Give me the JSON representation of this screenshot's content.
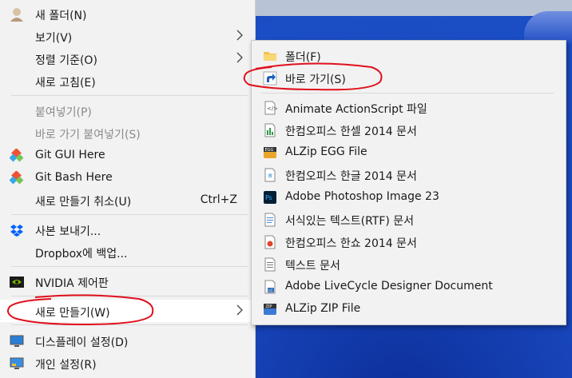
{
  "context_menu": {
    "items": [
      {
        "label": "새 폴더(N)",
        "icon": "avatar-icon"
      },
      {
        "label": "보기(V)",
        "has_submenu": true
      },
      {
        "label": "정렬 기준(O)",
        "has_submenu": true
      },
      {
        "label": "새로 고침(E)"
      },
      {
        "label": "붙여넣기(P)",
        "disabled": true
      },
      {
        "label": "바로 가기 붙여넣기(S)",
        "disabled": true
      },
      {
        "label": "Git GUI Here",
        "icon": "git-icon"
      },
      {
        "label": "Git Bash Here",
        "icon": "git-icon"
      },
      {
        "label": "새로 만들기 취소(U)",
        "shortcut": "Ctrl+Z"
      },
      {
        "label": "사본 보내기...",
        "icon": "dropbox-icon"
      },
      {
        "label": "Dropbox에 백업..."
      },
      {
        "label": "NVIDIA 제어판",
        "icon": "nvidia-icon"
      },
      {
        "label": "새로 만들기(W)",
        "has_submenu": true,
        "highlighted": true
      },
      {
        "label": "디스플레이 설정(D)",
        "icon": "display-icon"
      },
      {
        "label": "개인 설정(R)",
        "icon": "personalize-icon"
      }
    ]
  },
  "submenu_new": {
    "items": [
      {
        "label": "폴더(F)",
        "icon": "folder-icon"
      },
      {
        "label": "바로 가기(S)",
        "icon": "shortcut-icon"
      },
      {
        "label": "Animate ActionScript 파일",
        "icon": "actionscript-file-icon"
      },
      {
        "label": "한컴오피스 한셀 2014 문서",
        "icon": "hancell-icon"
      },
      {
        "label": "ALZip EGG File",
        "icon": "alzip-egg-icon"
      },
      {
        "label": "한컴오피스 한글 2014 문서",
        "icon": "hangul-icon"
      },
      {
        "label": "Adobe Photoshop Image 23",
        "icon": "photoshop-icon"
      },
      {
        "label": "서식있는 텍스트(RTF) 문서",
        "icon": "rtf-icon"
      },
      {
        "label": "한컴오피스 한쇼 2014 문서",
        "icon": "hanshow-icon"
      },
      {
        "label": "텍스트 문서",
        "icon": "text-document-icon"
      },
      {
        "label": "Adobe LiveCycle Designer Document",
        "icon": "livecycle-icon"
      },
      {
        "label": "ALZip ZIP File",
        "icon": "alzip-zip-icon"
      }
    ]
  },
  "colors": {
    "menu_bg": "#f2f2f2",
    "highlight_bg": "#ffffff",
    "annotation_red": "#e0101c",
    "desktop_blue": "#1b4dc4"
  }
}
